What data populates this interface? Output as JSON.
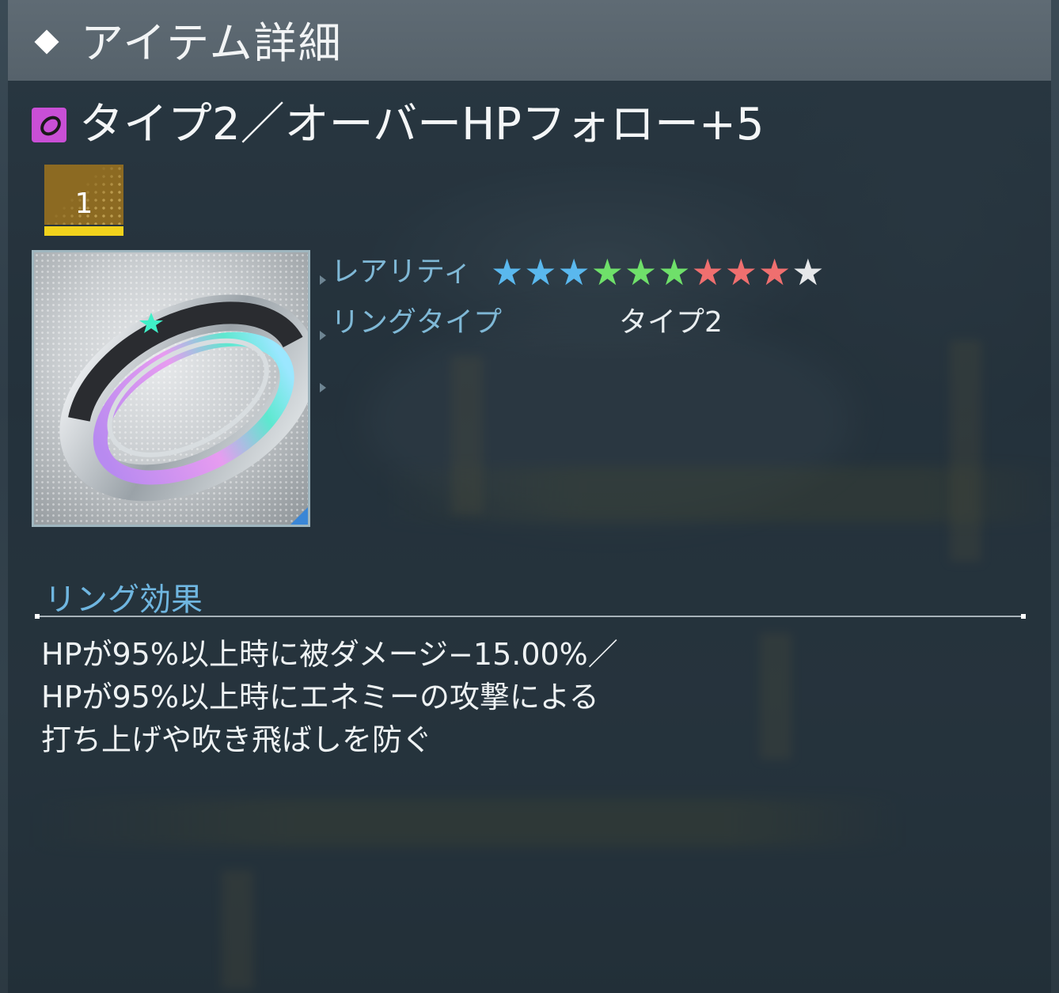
{
  "header": {
    "title": "アイテム詳細"
  },
  "item": {
    "type_icon": "ring-icon",
    "type_icon_color": "#c94fd6",
    "name": "タイプ2／オーバーHPフォロー+5",
    "level": "1",
    "image": "ring-image"
  },
  "stats": {
    "rarity_label": "レアリティ",
    "rarity_value": 10,
    "star_colors": [
      "#5ab8ee",
      "#5ab8ee",
      "#5ab8ee",
      "#6fe06a",
      "#6fe06a",
      "#6fe06a",
      "#ef6f6f",
      "#ef6f6f",
      "#ef6f6f",
      "#e6e8ea"
    ],
    "ring_type_label": "リングタイプ",
    "ring_type_value": "タイプ2"
  },
  "effect": {
    "heading": "リング効果",
    "lines": [
      "HPが95%以上時に被ダメージ−15.00%／",
      "HPが95%以上時にエネミーの攻撃による",
      "打ち上げや吹き飛ばしを防ぐ"
    ]
  }
}
